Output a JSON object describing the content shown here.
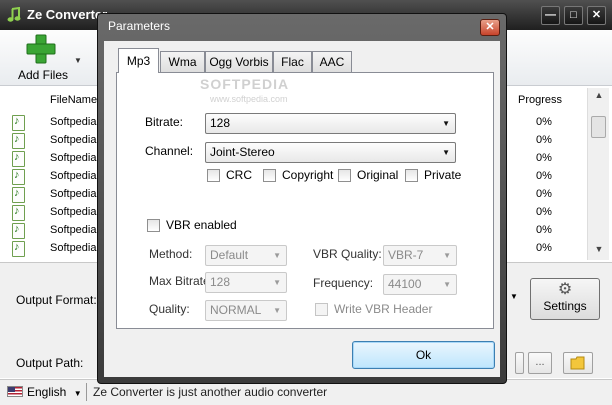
{
  "main_window": {
    "title": "Ze Converter",
    "controls": {
      "minimize": "—",
      "maximize": "□",
      "close": "✕"
    }
  },
  "toolbar": {
    "add_files_label": "Add Files",
    "add_files_caret": "▼"
  },
  "file_table": {
    "col_filename": "FileName",
    "col_progress": "Progress",
    "rows": [
      {
        "name": "Softpedia",
        "progress": "0%"
      },
      {
        "name": "Softpedia",
        "progress": "0%"
      },
      {
        "name": "Softpedia",
        "progress": "0%"
      },
      {
        "name": "Softpedia",
        "progress": "0%"
      },
      {
        "name": "Softpedia",
        "progress": "0%"
      },
      {
        "name": "Softpedia",
        "progress": "0%"
      },
      {
        "name": "Softpedia",
        "progress": "0%"
      },
      {
        "name": "Softpedia",
        "progress": "0%"
      }
    ]
  },
  "bottom": {
    "output_format_label": "Output Format:",
    "output_path_label": "Output Path:",
    "settings_label": "Settings",
    "browse_label": "..."
  },
  "statusbar": {
    "language": "English",
    "language_caret": "▼",
    "text": "Ze Converter is just another audio converter"
  },
  "dialog": {
    "title": "Parameters",
    "close": "✕",
    "tabs": [
      "Mp3",
      "Wma",
      "Ogg Vorbis",
      "Flac",
      "AAC"
    ],
    "active_tab": "Mp3",
    "bitrate": {
      "label": "Bitrate:",
      "value": "128"
    },
    "channel": {
      "label": "Channel:",
      "value": "Joint-Stereo"
    },
    "flags": {
      "crc": "CRC",
      "copyright": "Copyright",
      "original": "Original",
      "private": "Private"
    },
    "vbr_enabled": "VBR enabled",
    "method": {
      "label": "Method:",
      "value": "Default"
    },
    "max_bitrate": {
      "label": "Max Bitrate:",
      "value": "128"
    },
    "quality": {
      "label": "Quality:",
      "value": "NORMAL"
    },
    "vbr_quality": {
      "label": "VBR Quality:",
      "value": "VBR-7"
    },
    "frequency": {
      "label": "Frequency:",
      "value": "44100"
    },
    "write_vbr_header": "Write VBR Header",
    "ok_label": "Ok"
  },
  "watermark": {
    "text": "SOFTPEDIA",
    "sub": "www.softpedia.com"
  },
  "colors": {
    "accent_green": "#2e9e2a",
    "ok_button": "#bee6fd",
    "close_red": "#c7432a"
  }
}
